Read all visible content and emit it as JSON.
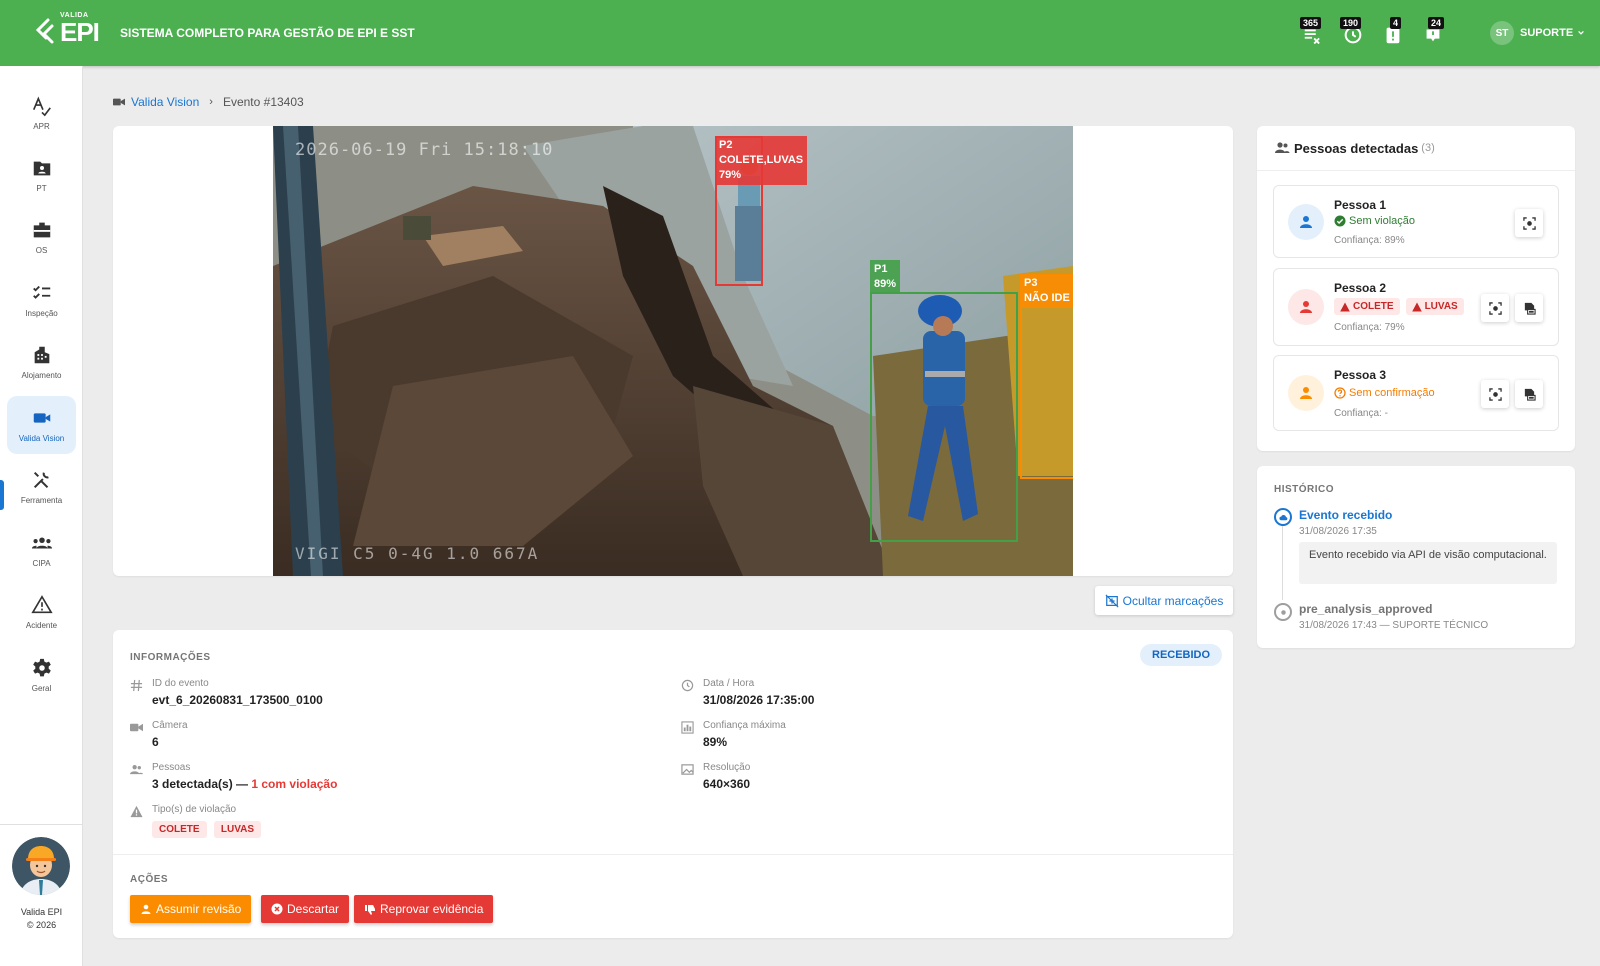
{
  "header": {
    "brand_small": "VALIDA",
    "brand_big": "EPI",
    "title": "SISTEMA COMPLETO PARA GESTÃO DE EPI E SST",
    "icons": [
      {
        "name": "pending-list-icon",
        "badge": "365"
      },
      {
        "name": "clock-history-icon",
        "badge": "190"
      },
      {
        "name": "alert-clipboard-icon",
        "badge": "4"
      },
      {
        "name": "notification-bell-icon",
        "badge": "24"
      }
    ],
    "user_initials": "ST",
    "user_label": "SUPORTE"
  },
  "sidebar": {
    "items": [
      {
        "label": "APR",
        "icon": "apr-icon"
      },
      {
        "label": "PT",
        "icon": "id-folder-icon"
      },
      {
        "label": "OS",
        "icon": "briefcase-icon"
      },
      {
        "label": "Inspeção",
        "icon": "checklist-icon"
      },
      {
        "label": "Alojamento",
        "icon": "building-icon"
      },
      {
        "label": "Valida Vision",
        "icon": "video-camera-icon",
        "active": true
      },
      {
        "label": "Ferramenta",
        "icon": "tools-icon"
      },
      {
        "label": "CIPA",
        "icon": "group-icon"
      },
      {
        "label": "Acidente",
        "icon": "warning-icon"
      },
      {
        "label": "Geral",
        "icon": "gear-icon"
      }
    ],
    "footer_name": "Valida EPI",
    "footer_year": "© 2026"
  },
  "breadcrumb": {
    "parent": "Valida Vision",
    "current": "Evento #13403"
  },
  "camera_image": {
    "timestamp_overlay": "2026-06-19 Fri 15:18:10",
    "camera_overlay": "VIGI C5 0-4G 1.0 667A",
    "detections": [
      {
        "id": "P2",
        "label": "COLETE,LUVAS",
        "confidence": "79%",
        "color": "#e53935"
      },
      {
        "id": "P1",
        "label": "",
        "confidence": "89%",
        "color": "#43a047"
      },
      {
        "id": "P3",
        "label": "NÃO IDE",
        "confidence": "",
        "color": "#fb8c00"
      }
    ]
  },
  "toggle_button": "Ocultar marcações",
  "info": {
    "title": "INFORMAÇÕES",
    "status": "RECEBIDO",
    "event_id_label": "ID do evento",
    "event_id": "evt_6_20260831_173500_0100",
    "datetime_label": "Data / Hora",
    "datetime": "31/08/2026 17:35:00",
    "camera_label": "Câmera",
    "camera": "6",
    "max_conf_label": "Confiança máxima",
    "max_conf": "89%",
    "people_label": "Pessoas",
    "people_detected": "3 detectada(s) —",
    "people_violation": "1 com violação",
    "resolution_label": "Resolução",
    "resolution": "640×360",
    "violation_type_label": "Tipo(s) de violação",
    "violation_types": [
      "COLETE",
      "LUVAS"
    ]
  },
  "actions": {
    "title": "AÇÕES",
    "buttons": [
      {
        "label": "Assumir revisão",
        "color": "#fb8c00"
      },
      {
        "label": "Descartar",
        "color": "#e53935"
      },
      {
        "label": "Reprovar evidência",
        "color": "#e53935"
      }
    ]
  },
  "people_panel": {
    "title": "Pessoas detectadas",
    "count": "(3)",
    "persons": [
      {
        "name": "Pessoa 1",
        "status": "Sem violação",
        "status_color": "#2e7d32",
        "confidence": "Confiança: 89%",
        "avatar_bg": "#e3f0fb",
        "avatar_color": "#1976d2"
      },
      {
        "name": "Pessoa 2",
        "chips": [
          "COLETE",
          "LUVAS"
        ],
        "confidence": "Confiança: 79%",
        "avatar_bg": "#fde7e7",
        "avatar_color": "#e53935"
      },
      {
        "name": "Pessoa 3",
        "status": "Sem confirmação",
        "status_color": "#f57c00",
        "confidence": "Confiança: -",
        "avatar_bg": "#fff1dc",
        "avatar_color": "#fb8c00"
      }
    ]
  },
  "history": {
    "title": "HISTÓRICO",
    "events": [
      {
        "title": "Evento recebido",
        "date": "31/08/2026 17:35",
        "note": "Evento recebido via API de visão computacional.",
        "color": "#1976d2"
      },
      {
        "title": "pre_analysis_approved",
        "date": "31/08/2026 17:43 — SUPORTE TÉCNICO",
        "color": "#9e9e9e"
      }
    ]
  }
}
